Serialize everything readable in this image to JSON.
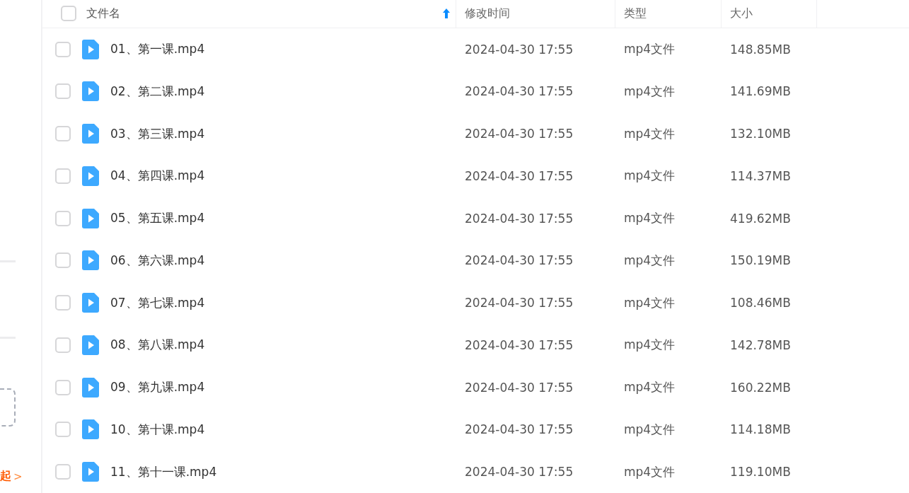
{
  "sidebar": {
    "link": "起",
    "link_arrow": ">"
  },
  "table": {
    "select_all_checked": false,
    "columns": [
      {
        "label": "文件名",
        "sorted": true
      },
      {
        "label": "修改时间",
        "sorted": false
      },
      {
        "label": "类型",
        "sorted": false
      },
      {
        "label": "大小",
        "sorted": false
      }
    ],
    "rows": [
      {
        "name": "01、第一课.mp4",
        "modified": "2024-04-30 17:55",
        "type": "mp4文件",
        "size": "148.85MB",
        "checked": false
      },
      {
        "name": "02、第二课.mp4",
        "modified": "2024-04-30 17:55",
        "type": "mp4文件",
        "size": "141.69MB",
        "checked": false
      },
      {
        "name": "03、第三课.mp4",
        "modified": "2024-04-30 17:55",
        "type": "mp4文件",
        "size": "132.10MB",
        "checked": false
      },
      {
        "name": "04、第四课.mp4",
        "modified": "2024-04-30 17:55",
        "type": "mp4文件",
        "size": "114.37MB",
        "checked": false
      },
      {
        "name": "05、第五课.mp4",
        "modified": "2024-04-30 17:55",
        "type": "mp4文件",
        "size": "419.62MB",
        "checked": false
      },
      {
        "name": "06、第六课.mp4",
        "modified": "2024-04-30 17:55",
        "type": "mp4文件",
        "size": "150.19MB",
        "checked": false
      },
      {
        "name": "07、第七课.mp4",
        "modified": "2024-04-30 17:55",
        "type": "mp4文件",
        "size": "108.46MB",
        "checked": false
      },
      {
        "name": "08、第八课.mp4",
        "modified": "2024-04-30 17:55",
        "type": "mp4文件",
        "size": "142.78MB",
        "checked": false
      },
      {
        "name": "09、第九课.mp4",
        "modified": "2024-04-30 17:55",
        "type": "mp4文件",
        "size": "160.22MB",
        "checked": false
      },
      {
        "name": "10、第十课.mp4",
        "modified": "2024-04-30 17:55",
        "type": "mp4文件",
        "size": "114.18MB",
        "checked": false
      },
      {
        "name": "11、第十一课.mp4",
        "modified": "2024-04-30 17:55",
        "type": "mp4文件",
        "size": "119.10MB",
        "checked": false
      }
    ]
  }
}
